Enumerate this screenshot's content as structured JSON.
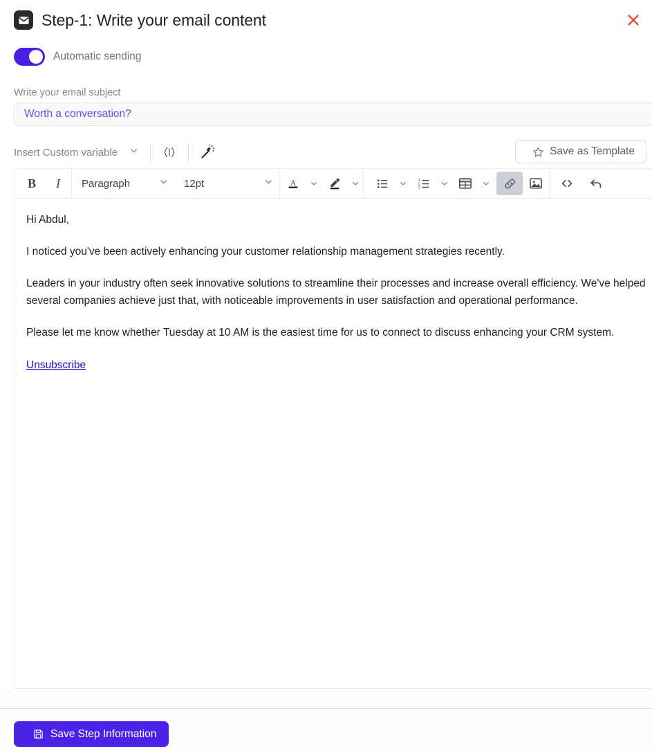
{
  "header": {
    "icon": "mail-icon",
    "title": "Step-1:  Write your email content",
    "close_icon": "close-icon"
  },
  "automatic_sending": {
    "label": "Automatic sending",
    "enabled": true,
    "accent_color": "#4920e0"
  },
  "subject": {
    "label": "Write your email subject",
    "value": "Worth a conversation?",
    "placeholder": "Write your email subject",
    "text_color": "#6448f0"
  },
  "variable_bar": {
    "select_label": "Insert Custom variable",
    "chevron_icon": "chevron-down-icon",
    "curly_icon": "curly-braces-icon",
    "curly_label": "{ | }",
    "wand_icon": "magic-wand-icon",
    "save_template_label": "Save as Template",
    "save_template_icon": "star-icon"
  },
  "editor_toolbar": {
    "bold_label": "B",
    "italic_label": "I",
    "block_format": "Paragraph",
    "font_size": "12pt",
    "text_color_icon": "text-color-icon",
    "highlight_icon": "highlight-color-icon",
    "bullet_list_icon": "bullet-list-icon",
    "numbered_list_icon": "numbered-list-icon",
    "table_icon": "table-icon",
    "link_icon": "link-icon",
    "link_active": true,
    "image_icon": "image-icon",
    "code_icon": "source-code-icon",
    "undo_icon": "undo-icon",
    "active_highlight_color": "#ccd0d6"
  },
  "email_body": {
    "greeting": "Hi Abdul,",
    "paragraph_1": "I noticed you've been actively enhancing your customer relationship management strategies recently.",
    "paragraph_2": "Leaders in your industry often seek innovative solutions to streamline their processes and increase overall efficiency. We've helped several companies achieve just that, with noticeable improvements in user satisfaction and operational performance.",
    "paragraph_3": "Please let me know whether Tuesday at 10 AM is the easiest time for us to connect to discuss enhancing your CRM system.",
    "unsubscribe_label": "Unsubscribe",
    "unsubscribe_color": "#1a12d0"
  },
  "footer": {
    "save_label": "Save Step Information",
    "save_icon": "floppy-disk-icon",
    "save_color": "#4a23e6"
  }
}
